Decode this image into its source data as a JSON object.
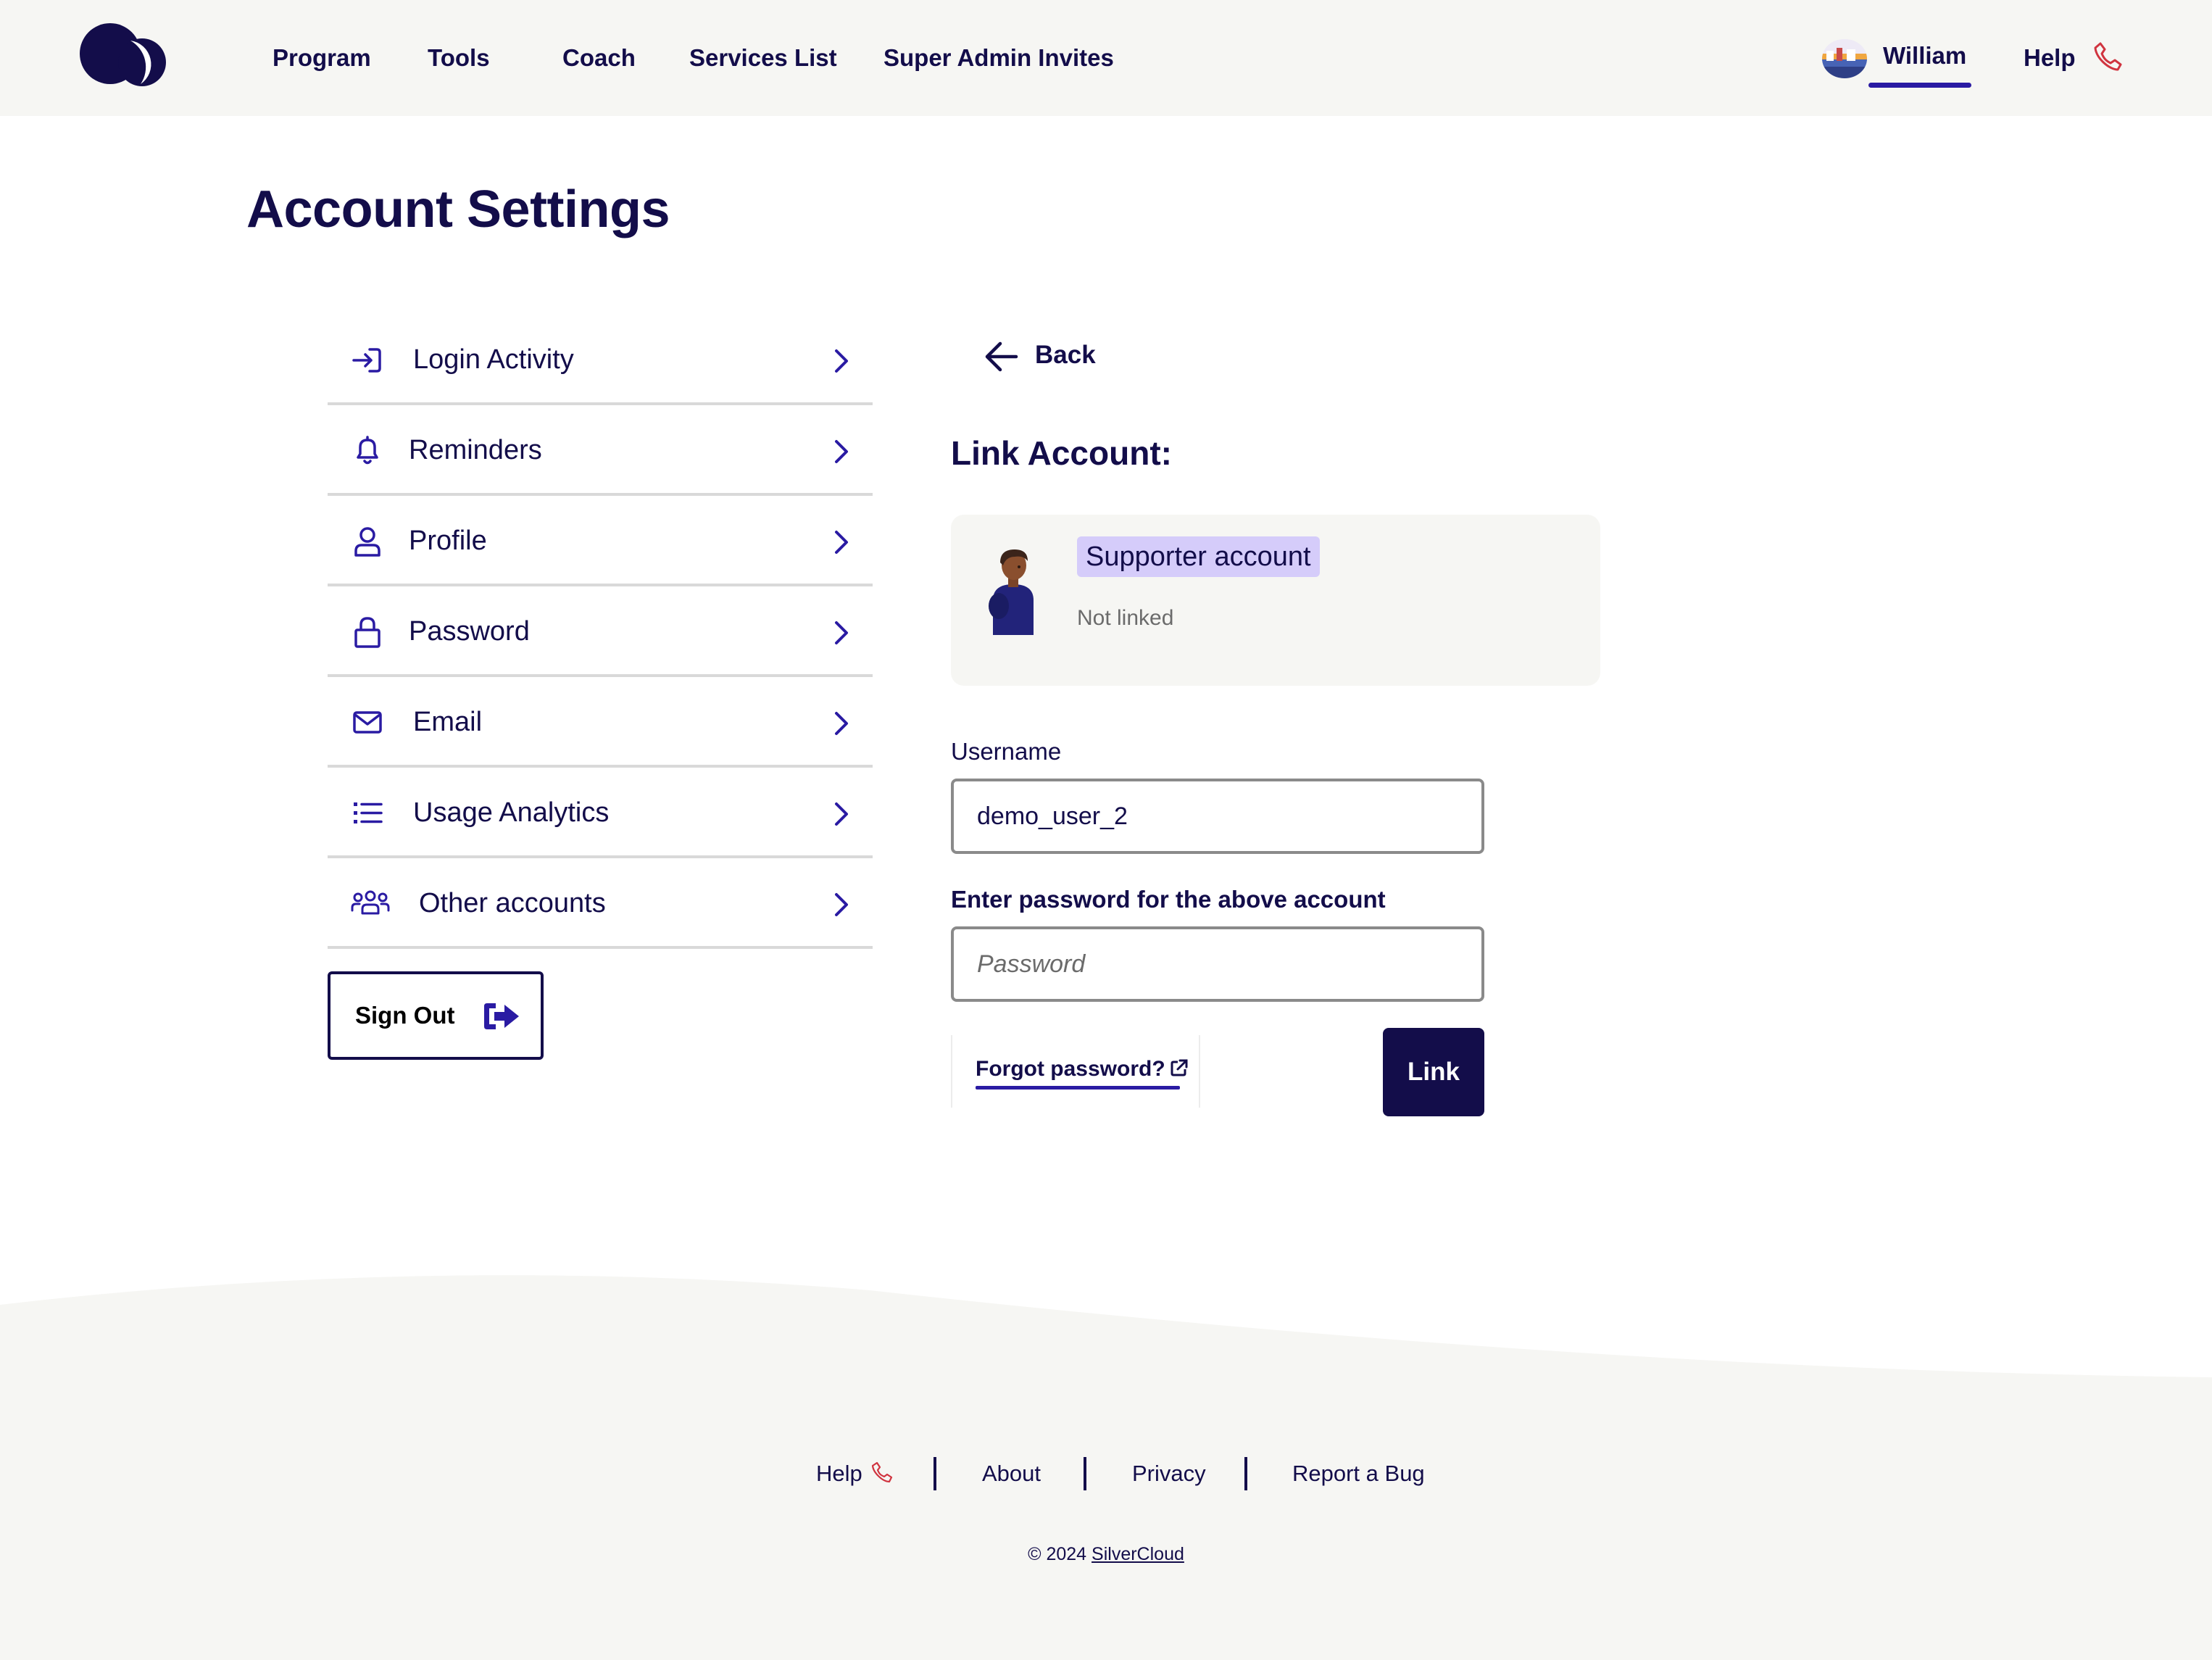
{
  "nav": {
    "items": [
      {
        "label": "Program"
      },
      {
        "label": "Tools"
      },
      {
        "label": "Coach"
      },
      {
        "label": "Services List"
      },
      {
        "label": "Super Admin Invites"
      }
    ],
    "user_name": "William",
    "help_label": "Help"
  },
  "page": {
    "title": "Account Settings"
  },
  "menu": {
    "items": [
      {
        "label": "Login Activity",
        "icon": "login-icon"
      },
      {
        "label": "Reminders",
        "icon": "bell-icon"
      },
      {
        "label": "Profile",
        "icon": "person-icon"
      },
      {
        "label": "Password",
        "icon": "lock-icon"
      },
      {
        "label": "Email",
        "icon": "envelope-icon"
      },
      {
        "label": "Usage Analytics",
        "icon": "list-icon"
      },
      {
        "label": "Other accounts",
        "icon": "group-icon"
      }
    ],
    "signout_label": "Sign Out"
  },
  "link_panel": {
    "back_label": "Back",
    "title": "Link Account:",
    "account_type": "Supporter account",
    "account_status": "Not linked",
    "username_label": "Username",
    "username_value": "demo_user_2",
    "password_label": "Enter password for the above account",
    "password_placeholder": "Password",
    "forgot_label": "Forgot password?",
    "link_button": "Link"
  },
  "footer": {
    "links": [
      {
        "label": "Help"
      },
      {
        "label": "About"
      },
      {
        "label": "Privacy"
      },
      {
        "label": "Report a Bug"
      }
    ],
    "copyright_prefix": "© 2024",
    "copyright_brand": "SilverCloud"
  },
  "colors": {
    "brand_navy": "#130d4a",
    "accent_purple": "#2a1ba3",
    "badge_lavender": "#d5ccfa",
    "help_red": "#d0343f",
    "surface_gray": "#f6f6f3"
  }
}
